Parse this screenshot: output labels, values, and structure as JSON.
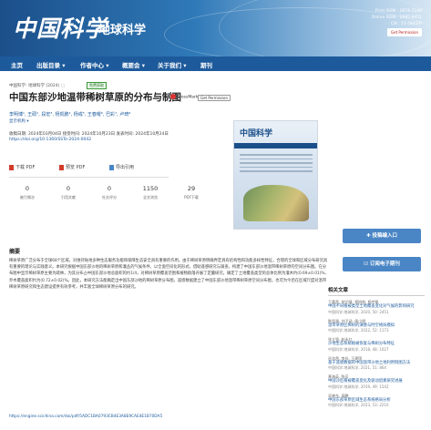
{
  "header": {
    "logo_cn": "中国科学",
    "logo_sub": "地球科学",
    "issn_print": "Print ISSN : 1674-7240",
    "issn_online": "Online ISSN : 2095-9451",
    "cn": "CN : 11-5842/P",
    "get_permission": "Get Permission"
  },
  "nav": {
    "items": [
      "主页",
      "出版目录 ▾",
      "作者中心 ▾",
      "概要会 ▾",
      "关于我们 ▾",
      "期刊"
    ]
  },
  "article": {
    "breadcrumb": "中国科学: 地球科学 (2024) ⬚",
    "oa": "免费获取",
    "title": "中国东部沙地温带稀树草原的分布与制图",
    "crossmark": "CrossMark",
    "get_permission": "Get Permission",
    "authors": "李明博¹, 王硕², 段宏³, 杨凯鹏⁴, 杨彧⁵, 王春曜⁶, 巴彩⁷, 卢琦⁸",
    "affiliation": "显示机构 ▾",
    "dates": "收稿日期: 2024年03月04日   接受时间: 2024年10月23日   发表时间: 2024年10月24日",
    "doi": "https://doi.org/10.1360/SSTe-2024-0042"
  },
  "actions": {
    "full_pdf": "下载 PDF",
    "snap_pdf": "预览 PDF",
    "export": "导出引用"
  },
  "metrics": [
    {
      "value": "0",
      "label": "被引频次"
    },
    {
      "value": "0",
      "label": "引用文献"
    },
    {
      "value": "0",
      "label": "社交评分"
    },
    {
      "value": "1150",
      "label": "全文浏览"
    },
    {
      "value": "29",
      "label": "PDF下载"
    }
  ],
  "cover": {
    "title": "中国科学"
  },
  "buttons": {
    "submit": "✚ 投稿编入口",
    "subscribe": "☑ 订阅电子期刊"
  },
  "abstract": {
    "heading": "摘要",
    "text": "稀树草原广泛分布于全球68个区域，对维持陆地多种生态服务功能和保障生态安全具有重要的作用。由于稀树草原明确界定具有结构性和功能多样性特征，合理的全球和区域分布研究具有重要的理论与实践意义。本研究根据中国东部沙地的稀树草原和灌丛的气候条件，以全面空间化的形式，借助遥感研究与调查，构建了中国东部沙地温带稀树草原的空间分布图。在分布图中显示稀树草原主要为疏林，为其分布占中国东部沙地总面积的约1/4，对稀树草原覆盖范围和植物群落开展了定量研究，确定了土地覆盖类型的总体比例为灌木约(0.69±0.01)%、乔木覆盖面积约为(0.72±0.02)%。因此，本研究方法能确定出中国东部沙地的稀树草原分布图，遥感数据建立了中国东部沙地温带稀树草原空间分布图，也可为今后在区域尺度对温带稀树草原研究和生态建设提供有效参考，并丰富全球稀树草原分布的研究。",
    "url": "https://engine.scichina.com/doi/pdf/5ADC1BA0793CB4E3A8E9CAE4E1B70DA5"
  },
  "related": {
    "heading": "相关文章",
    "items": [
      {
        "authors": "王嘉然, 胡芷晴, 郑旭航, 杨宇帆",
        "title": "中国不同植被类型土地覆盖变化对气候的影响研究",
        "meta": "中国科学:地球科学, 2020, 50: 2451"
      },
      {
        "authors": "陈思源, 刘子涵, 周小明",
        "title": "温带草原区稀树的演替与时空格局模拟",
        "meta": "中国科学:地球科学, 2022, 52: 1173"
      },
      {
        "authors": "张立强, 赵永红",
        "title": "沙地生态系统植被恢复与稀树分布特征",
        "meta": "中国科学:地球科学, 2018, 48: 1027"
      },
      {
        "authors": "孙浩然, 李佳, 王建国",
        "title": "基于遥感数据的中国温带沙地土地利用制图方法",
        "meta": "中国科学:地球科学, 2021, 51: 864"
      },
      {
        "authors": "黄海英, 陈芳",
        "title": "中国沙区植被覆盖变化及驱动因素研究进展",
        "meta": "中国科学:地球科学, 2019, 49: 1542"
      },
      {
        "authors": "吴晓东, 高鹏",
        "title": "中国东部草原区域生态系统格局分析",
        "meta": "中国科学:地球科学, 2023, 53: 2210"
      }
    ]
  },
  "colors": {
    "brand": "#1d5a9c",
    "button": "#4a86c5",
    "pdf_icon": "#d23a2a"
  }
}
